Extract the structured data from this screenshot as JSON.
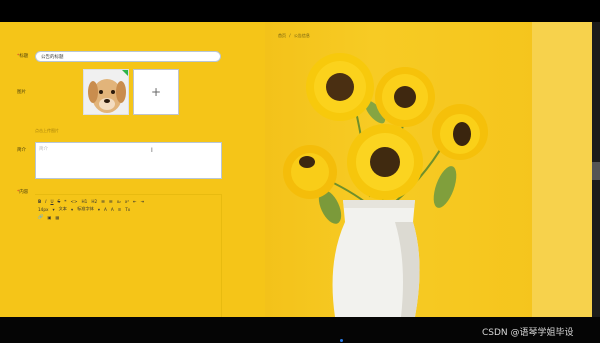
{
  "breadcrumb": {
    "home": "首页",
    "separator": "/",
    "current": "公告信息"
  },
  "form": {
    "title_label": "标题",
    "title_value": "公告的标题",
    "image_label": "图片",
    "upload_symbol": "+",
    "upload_hint": "点击上传图片",
    "summary_label": "简介",
    "summary_placeholder": "简介",
    "content_label": "内容"
  },
  "editor_toolbar": {
    "row1": [
      "B",
      "I",
      "U",
      "S",
      "❝",
      "<>",
      "H1",
      "H2",
      "☰",
      "☰",
      "x₂",
      "x²",
      "⇤",
      "⇥"
    ],
    "row2": [
      "14px",
      "▾",
      "文本",
      "▾",
      "标准字体",
      "▾",
      "A",
      "A",
      "≡",
      "Tx"
    ],
    "row3": [
      "🔗",
      "▣",
      "▦"
    ]
  },
  "footer": {
    "watermark": "CSDN @语琴学姐毕设"
  },
  "colors": {
    "page_background": "#f5c518",
    "accent": "#2b7de9",
    "input_border": "#b8c6d6"
  }
}
